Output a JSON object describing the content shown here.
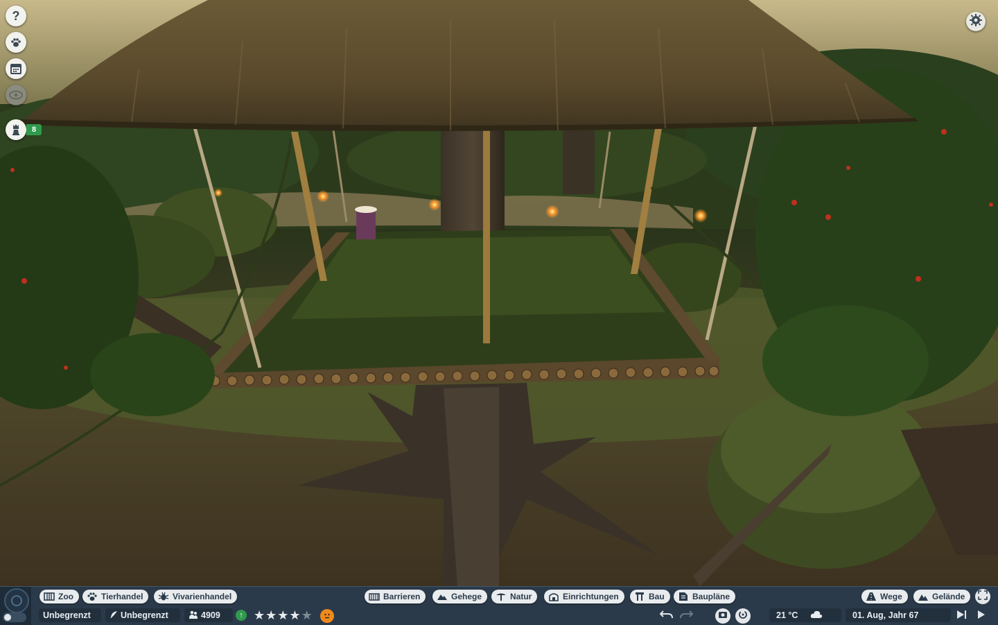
{
  "hud": {
    "left_tabs": [
      {
        "label": "Zoo",
        "icon": "zoo-icon"
      },
      {
        "label": "Tierhandel",
        "icon": "paw-icon"
      },
      {
        "label": "Vivarienhandel",
        "icon": "bug-icon"
      }
    ],
    "center_tabs": [
      {
        "label": "Barrieren",
        "icon": "fence-icon"
      },
      {
        "label": "Gehege",
        "icon": "habitat-icon"
      },
      {
        "label": "Natur",
        "icon": "tree-icon"
      },
      {
        "label": "Einrichtungen",
        "icon": "building-icon"
      },
      {
        "label": "Bau",
        "icon": "construction-icon"
      },
      {
        "label": "Baupläne",
        "icon": "blueprint-icon"
      }
    ],
    "right_tabs": [
      {
        "label": "Wege",
        "icon": "path-icon"
      },
      {
        "label": "Gelände",
        "icon": "terrain-icon"
      }
    ],
    "money": "Unbegrenzt",
    "research": "Unbegrenzt",
    "guests": "4909",
    "rating_stars": 4,
    "rating_max": 5,
    "temperature": "21 °C",
    "date": "01. Aug, Jahr 67"
  },
  "sidebar": {
    "help_label": "?",
    "notification_count": "8"
  },
  "colors": {
    "hud_bg": "#2b3a4a",
    "tab_bg": "#e9ecee",
    "badge_green": "#2f9a4c",
    "mood_orange": "#f08a1c"
  }
}
